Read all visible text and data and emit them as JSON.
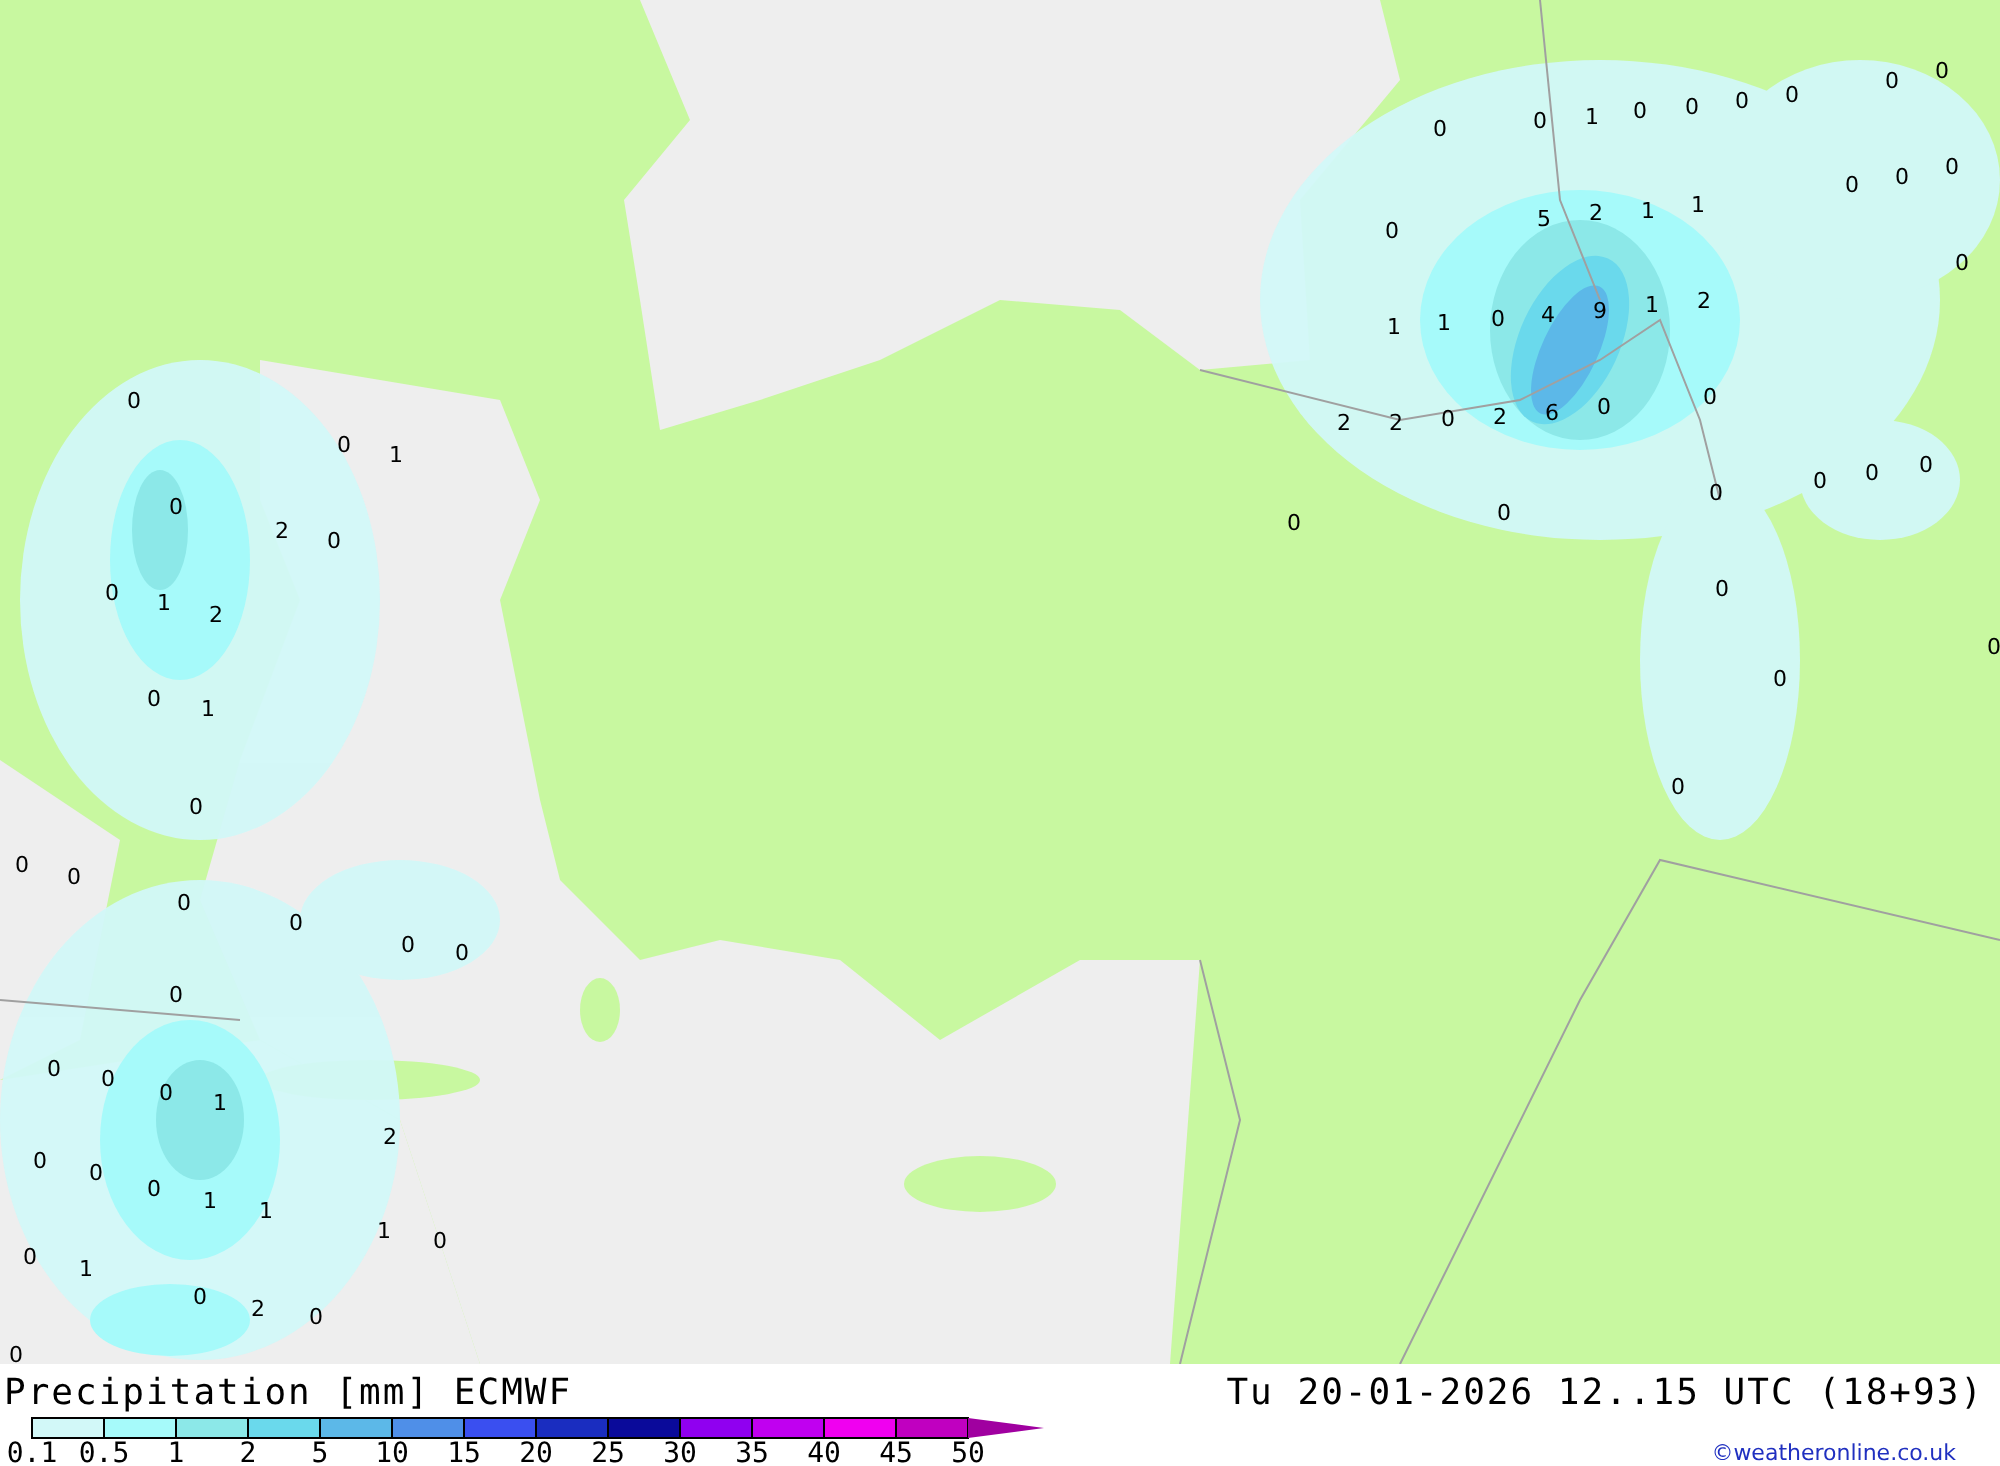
{
  "map": {
    "values": [
      "0",
      "0",
      "1",
      "0",
      "0",
      "0",
      "0",
      "0",
      "0",
      "0",
      "0",
      "0",
      "0",
      "5",
      "2",
      "1",
      "1",
      "0",
      "1",
      "1",
      "0",
      "4",
      "9",
      "1",
      "2",
      "0",
      "2",
      "2",
      "0",
      "2",
      "6",
      "0",
      "0",
      "0",
      "0",
      "0",
      "0",
      "0",
      "0",
      "0",
      "0",
      "0",
      "0",
      "0",
      "1",
      "0",
      "2",
      "0",
      "0",
      "1",
      "2",
      "0",
      "1",
      "0",
      "0",
      "0",
      "0",
      "0",
      "0",
      "0",
      "0",
      "0",
      "0",
      "0",
      "1",
      "2",
      "0",
      "0",
      "0",
      "1",
      "1",
      "1",
      "0",
      "0",
      "1",
      "0",
      "2",
      "0",
      "0"
    ]
  },
  "footer": {
    "title": "Precipitation [mm] ECMWF",
    "datetime": "Tu 20-01-2026 12..15 UTC (18+93)",
    "credit": "©weatheronline.co.uk",
    "legend": [
      {
        "color": "#d2f8f8"
      },
      {
        "color": "#a6fafa"
      },
      {
        "color": "#8ce8e8"
      },
      {
        "color": "#6ad9ec"
      },
      {
        "color": "#5cb8e8"
      },
      {
        "color": "#4f8fe8"
      },
      {
        "color": "#3a4ff0"
      },
      {
        "color": "#1a2dc0"
      },
      {
        "color": "#0a0a9a"
      },
      {
        "color": "#9000f0"
      },
      {
        "color": "#c000f0"
      },
      {
        "color": "#f000f0"
      },
      {
        "color": "#c000c0"
      }
    ],
    "legend_labels": [
      "0.1",
      "0.5",
      "1",
      "2",
      "5",
      "10",
      "15",
      "20",
      "25",
      "30",
      "35",
      "40",
      "45",
      "50"
    ]
  }
}
